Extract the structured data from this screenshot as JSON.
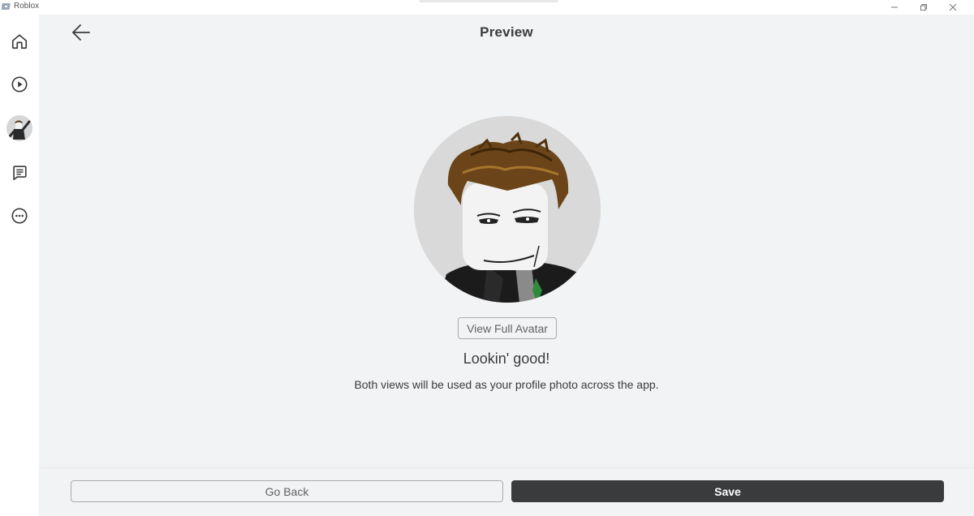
{
  "window": {
    "app_title": "Roblox",
    "app_icon": "roblox-logo-icon",
    "controls": {
      "minimize": "minimize-icon",
      "restore": "restore-icon",
      "close": "close-icon"
    }
  },
  "sidebar": {
    "items": [
      {
        "name": "home",
        "icon": "home-icon"
      },
      {
        "name": "play",
        "icon": "play-icon"
      },
      {
        "name": "avatar",
        "icon": "avatar-thumbnail"
      },
      {
        "name": "chat",
        "icon": "chat-icon"
      },
      {
        "name": "more",
        "icon": "more-icon"
      }
    ]
  },
  "header": {
    "back_icon": "arrow-left-icon",
    "title": "Preview"
  },
  "main": {
    "view_full_avatar_label": "View Full Avatar",
    "headline": "Lookin' good!",
    "description": "Both views will be used as your profile photo across the app."
  },
  "footer": {
    "go_back_label": "Go Back",
    "save_label": "Save"
  },
  "colors": {
    "background": "#f2f3f5",
    "sidebar": "#ffffff",
    "primary_button": "#393b3d",
    "text": "#393b3d",
    "avatar_backdrop": "#d9d9d9"
  }
}
